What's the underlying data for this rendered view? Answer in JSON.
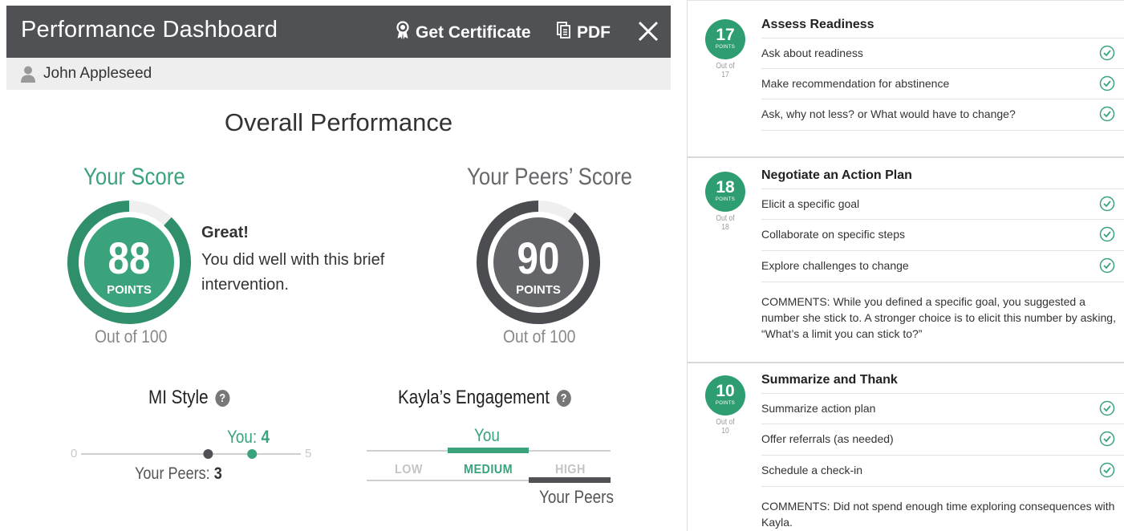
{
  "dashboard": {
    "title": "Performance Dashboard",
    "certificate_label": "Get Certificate",
    "pdf_label": "PDF",
    "user_name": "John Appleseed"
  },
  "overall": {
    "title": "Overall Performance",
    "your_score": {
      "label": "Your Score",
      "value": "88",
      "unit": "POINTS",
      "out_of": "Out of 100",
      "fraction": 0.88
    },
    "peers_score": {
      "label": "Your Peers’ Score",
      "value": "90",
      "unit": "POINTS",
      "out_of": "Out of 100",
      "fraction": 0.9
    },
    "feedback_title": "Great!",
    "feedback_text": "You did well with this brief intervention."
  },
  "mi_style": {
    "title": "MI Style",
    "min_label": "0",
    "max_label": "5",
    "you_prefix": "You: ",
    "you_value": "4",
    "peers_prefix": "Your Peers: ",
    "peers_value": "3",
    "scale_max": 5
  },
  "engagement": {
    "title": "Kayla’s Engagement",
    "you_label": "You",
    "levels": [
      "LOW",
      "MEDIUM",
      "HIGH"
    ],
    "you_level": "MEDIUM",
    "peers_label": "Your Peers",
    "peers_level": "HIGH"
  },
  "sections": [
    {
      "points": "17",
      "points_unit": "POINTS",
      "out_of": "Out of 17",
      "title": "Assess Readiness",
      "items": [
        "Ask about readiness",
        "Make recommendation for abstinence",
        "Ask, why not less? or What would have to change?"
      ],
      "comment": ""
    },
    {
      "points": "18",
      "points_unit": "POINTS",
      "out_of": "Out of 18",
      "title": "Negotiate an Action Plan",
      "items": [
        "Elicit a specific goal",
        "Collaborate on specific steps",
        "Explore challenges to change"
      ],
      "comment": "COMMENTS: While you defined a specific goal, you suggested a number she stick to. A stronger choice is to elicit this number by asking, “What’s a limit you can stick to?”"
    },
    {
      "points": "10",
      "points_unit": "POINTS",
      "out_of": "Out of 10",
      "title": "Summarize and Thank",
      "items": [
        "Summarize action plan",
        "Offer referrals (as needed)",
        "Schedule a check-in"
      ],
      "comment": "COMMENTS: Did not spend enough time exploring consequences with Kayla."
    }
  ],
  "colors": {
    "accent": "#3aa37c",
    "accent_dark": "#2e8f6a",
    "peer": "#5e6063",
    "topbar": "#4f5154"
  },
  "icons": [
    "award-icon",
    "document-icon",
    "close-icon",
    "user-icon",
    "help-icon",
    "check-circle-icon"
  ]
}
